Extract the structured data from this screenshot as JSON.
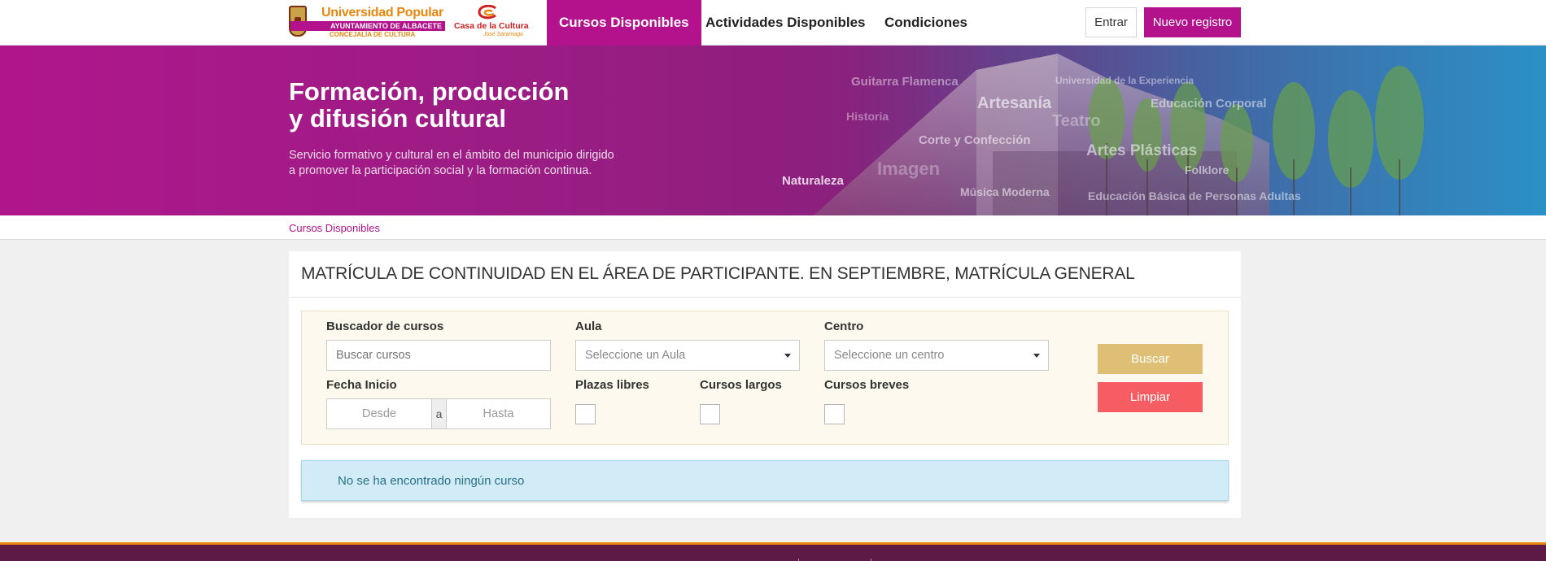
{
  "header": {
    "logo_up": {
      "title": "Universidad Popular",
      "band": "AYUNTAMIENTO DE ALBACETE",
      "sub": "CONCEJALÍA DE CULTURA"
    },
    "logo_casa": {
      "title": "Casa de la Cultura",
      "sub": "José Saramago"
    },
    "nav": [
      "Cursos Disponibles",
      "Actividades Disponibles",
      "Condiciones"
    ],
    "login_label": "Entrar",
    "register_label": "Nuevo registro"
  },
  "hero": {
    "title_line1": "Formación, producción",
    "title_line2": "y difusión cultural",
    "subtitle_line1": "Servicio formativo y cultural en el ámbito del municipio dirigido",
    "subtitle_line2": "a promover la participación social y la formación continua.",
    "tags": [
      "Guitarra Flamenca",
      "Universidad de la Experiencia",
      "Artesanía",
      "Educación Corporal",
      "Historia",
      "Teatro",
      "Corte y Confección",
      "Artes Plásticas",
      "Imagen",
      "Folklore",
      "Naturaleza",
      "Música Moderna",
      "Educación Básica de Personas Adultas"
    ]
  },
  "breadcrumb": "Cursos Disponibles",
  "main": {
    "title": "MATRÍCULA DE CONTINUIDAD EN EL ÁREA DE PARTICIPANTE. EN SEPTIEMBRE, MATRÍCULA GENERAL",
    "filters": {
      "search_label": "Buscador de cursos",
      "search_placeholder": "Buscar cursos",
      "aula_label": "Aula",
      "aula_value": "Seleccione un Aula",
      "centro_label": "Centro",
      "centro_value": "Seleccione un centro",
      "fecha_label": "Fecha Inicio",
      "desde_placeholder": "Desde",
      "date_separator": "a",
      "hasta_placeholder": "Hasta",
      "plazas_label": "Plazas libres",
      "largos_label": "Cursos largos",
      "breves_label": "Cursos breves",
      "buscar_label": "Buscar",
      "limpiar_label": "Limpiar"
    },
    "alert": "No se ha encontrado ningún curso"
  },
  "colors": {
    "brand": "#b3128c",
    "buscar": "#dfbf76",
    "limpiar": "#f55d62",
    "alert_bg": "#d1ecf6",
    "footer": "#5e1a46"
  }
}
